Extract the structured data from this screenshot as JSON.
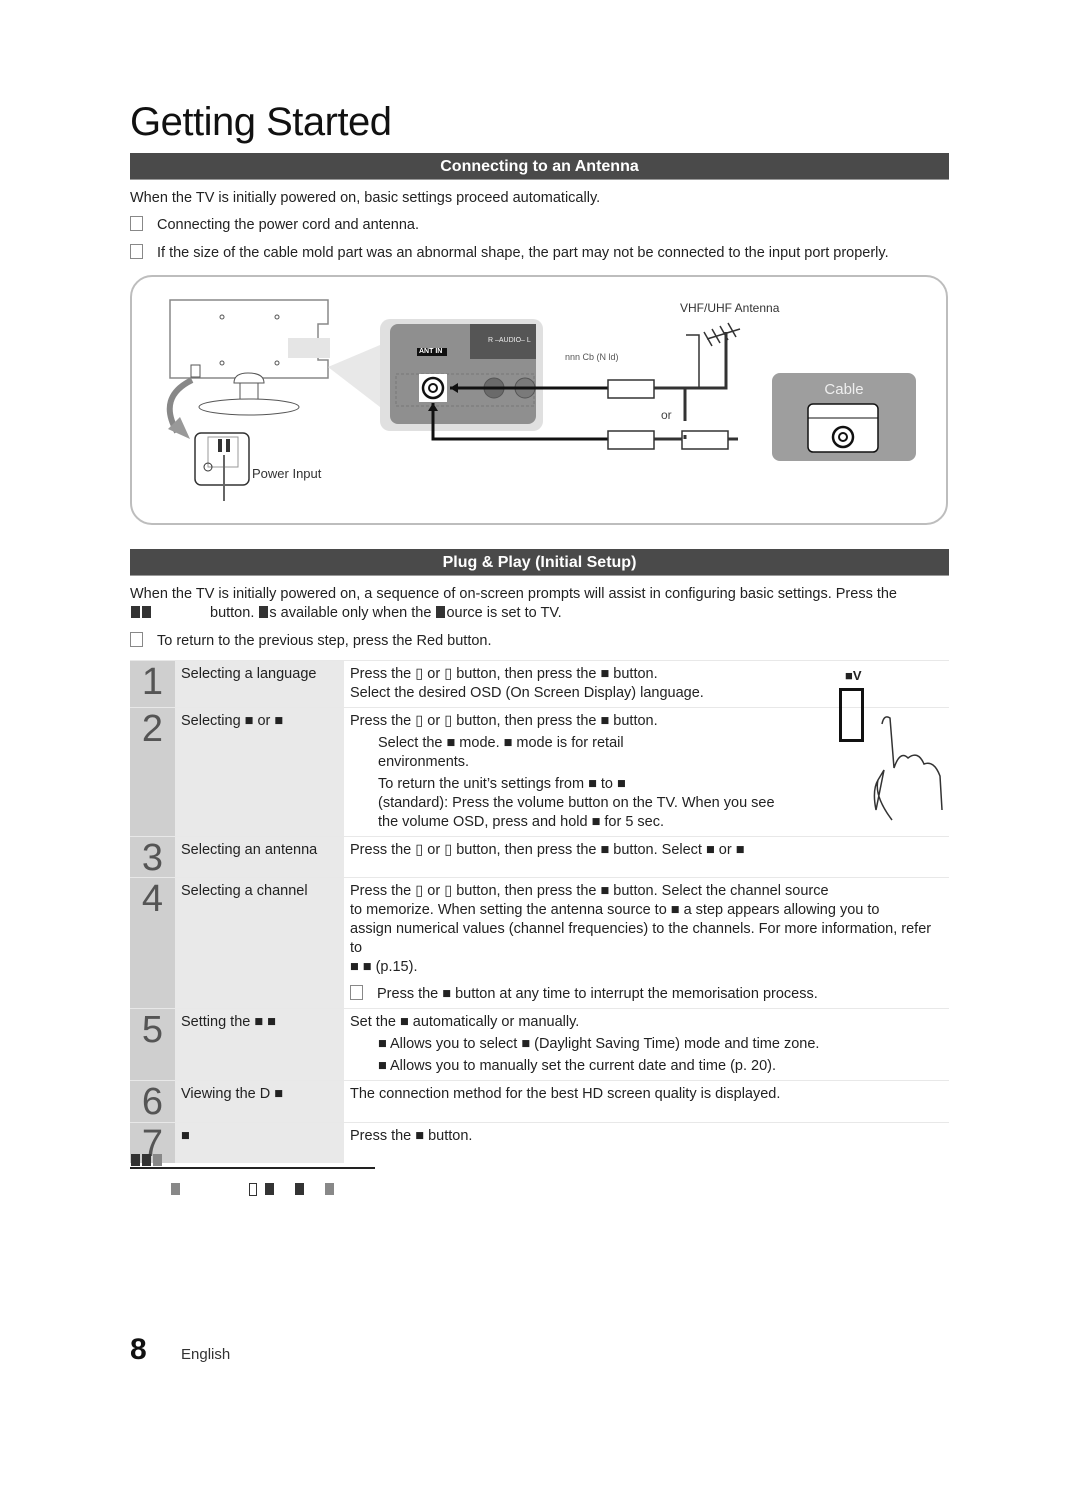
{
  "page_title": "Getting Started",
  "section1": {
    "header": "Connecting to an Antenna",
    "intro": "When the TV is initially powered on, basic settings proceed automatically.",
    "notes": [
      "Connecting the power cord and antenna.",
      "If the size of the cable mold part was an abnormal shape, the part may not be connected to the input port properly."
    ],
    "diagram": {
      "antenna_label": "VHF/UHF Antenna",
      "cable_caption": "nnn Cb (N ld)",
      "or_label": "or",
      "cable_box_label": "Cable",
      "ant_in_label": "ANT IN",
      "audio_label": "R –AUDIO– L",
      "power_input_label": "Power Input"
    }
  },
  "section2": {
    "header": "Plug & Play (Initial Setup)",
    "intro_line1": "When the TV is initially powered on, a sequence of on-screen prompts will assist in configuring basic settings. Press the",
    "intro_line2_a": "button.",
    "intro_line2_b": "s available only when the",
    "intro_line2_c": "ource is set to TV.",
    "note": "To return to the previous step, press the Red button.",
    "remote_label": "■V",
    "steps": [
      {
        "num": "1",
        "label": "Selecting a language",
        "lines": [
          "Press the ▯ or ▯ button, then press the ■ button.",
          "Select the desired OSD (On Screen Display) language."
        ]
      },
      {
        "num": "2",
        "label": "Selecting ■ or ■",
        "lines": [
          "Press the ▯ or ▯ button, then press the ■ button.",
          "Select the ■ mode. ■ mode is for retail",
          "environments.",
          "To return the unit’s settings from ■ to ■",
          "(standard): Press the volume button on the TV. When you see",
          "the volume OSD, press and hold ■ for 5 sec."
        ]
      },
      {
        "num": "3",
        "label": "Selecting an antenna",
        "lines": [
          "Press the ▯ or ▯ button, then press the ■ button. Select ■ or ■"
        ]
      },
      {
        "num": "4",
        "label": "Selecting a channel",
        "lines": [
          "Press the ▯ or ▯ button, then press the ■ button. Select the channel source",
          "to memorize. When setting the antenna source to ■ a step appears allowing you to",
          "assign numerical values (channel frequencies) to the channels. For more information, refer to",
          "■ ■ (p.15).",
          "Press the ■ button at any time to interrupt the memorisation process."
        ]
      },
      {
        "num": "5",
        "label": "Setting the ■ ■",
        "lines": [
          "Set the ■ automatically or manually.",
          "■ Allows you to select ■ (Daylight Saving Time) mode and time zone.",
          "■ Allows you to manually set the current date and time (p. 20)."
        ]
      },
      {
        "num": "6",
        "label": "Viewing the D ■",
        "lines": [
          "The connection method for the best HD screen quality is displayed."
        ]
      },
      {
        "num": "7",
        "label": "■",
        "lines": [
          "Press the ■ button."
        ]
      }
    ]
  },
  "footer": {
    "page_number": "8",
    "language": "English"
  }
}
